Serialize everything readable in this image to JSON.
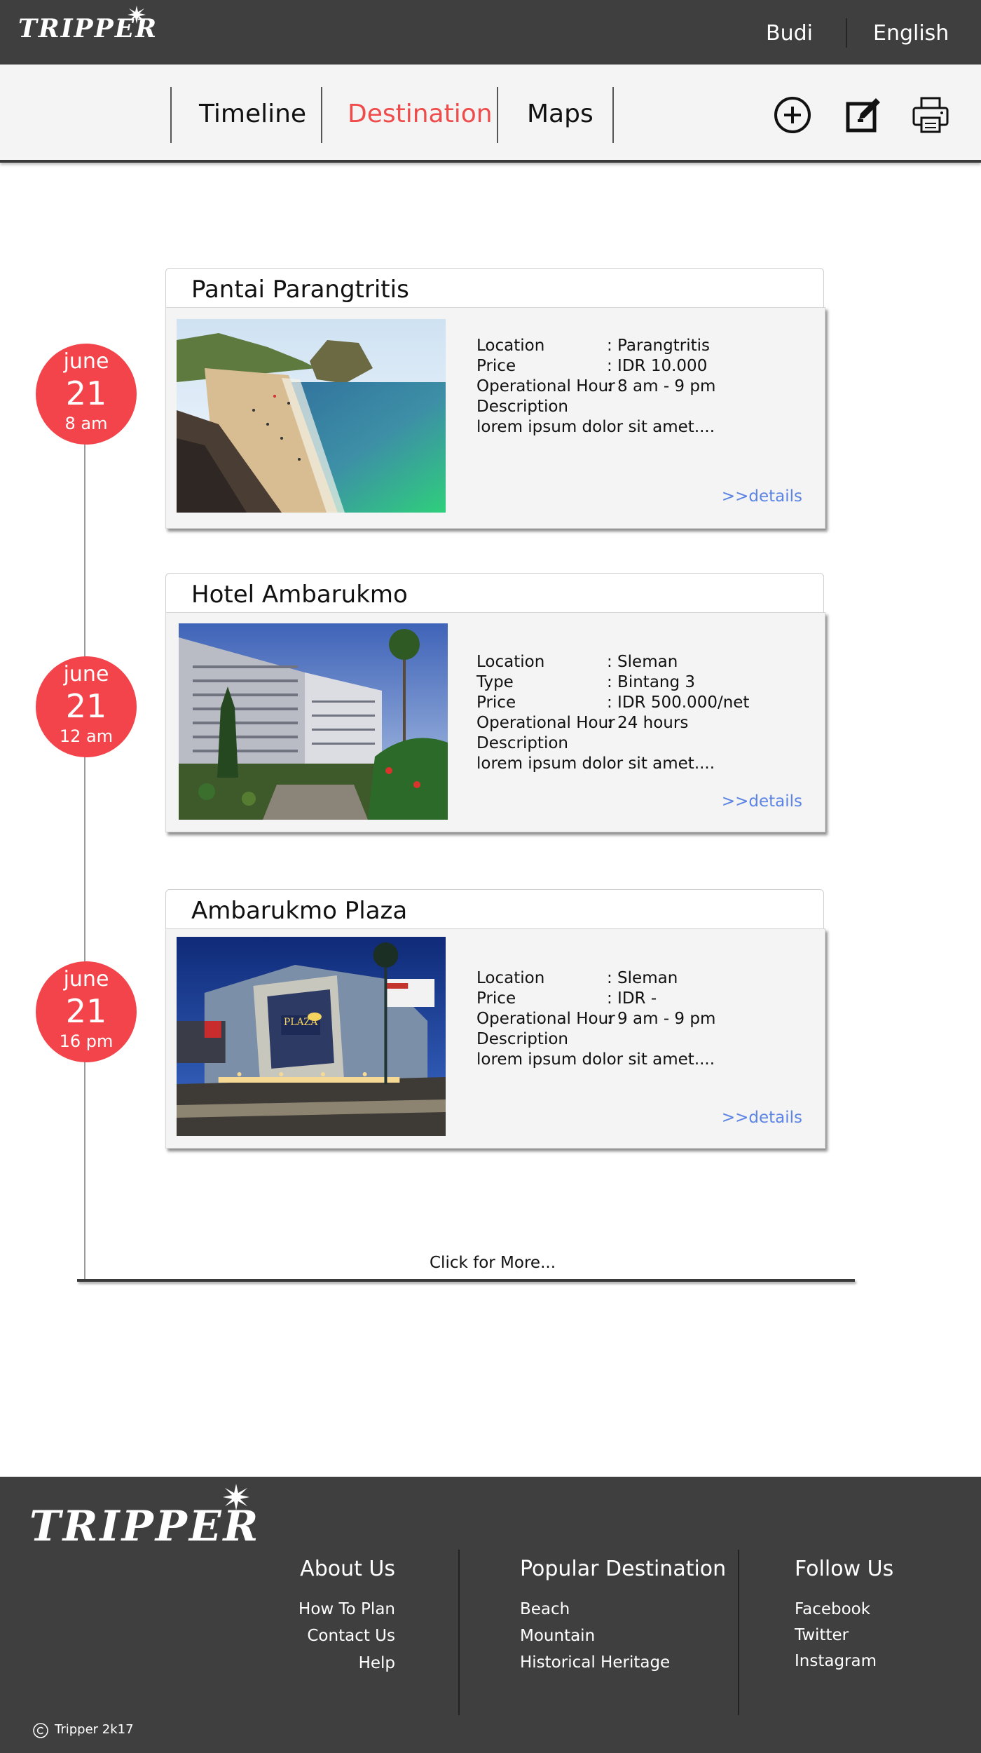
{
  "header": {
    "brand": "TRIPPER",
    "user": "Budi",
    "language": "English"
  },
  "nav": {
    "tabs": [
      "Timeline",
      "Destination",
      "Maps"
    ],
    "active_tab": "Destination",
    "icons": [
      "plus-circle-icon",
      "edit-icon",
      "printer-icon"
    ]
  },
  "timeline": [
    {
      "month": "june",
      "day": "21",
      "time": "8 am",
      "title": "Pantai Parangtritis",
      "image": "beach photo",
      "rows": [
        {
          "label": "Location",
          "value": ": Parangtritis"
        },
        {
          "label": "Price",
          "value": ": IDR 10.000"
        },
        {
          "label": "Operational Hour",
          "value": ": 8 am - 9 pm"
        },
        {
          "label": "Description",
          "value": ""
        },
        {
          "label": "lorem ipsum dolor sit amet....",
          "value": ""
        }
      ],
      "details": ">>details"
    },
    {
      "month": "june",
      "day": "21",
      "time": "12 am",
      "title": "Hotel Ambarukmo",
      "image": "hotel photo",
      "rows": [
        {
          "label": "Location",
          "value": ": Sleman"
        },
        {
          "label": "Type",
          "value": ": Bintang 3"
        },
        {
          "label": "Price",
          "value": ": IDR 500.000/net"
        },
        {
          "label": "Operational Hour",
          "value": ": 24 hours"
        },
        {
          "label": "Description",
          "value": ""
        },
        {
          "label": "lorem ipsum dolor sit amet....",
          "value": ""
        }
      ],
      "details": ">>details"
    },
    {
      "month": "june",
      "day": "21",
      "time": "16 pm",
      "title": "Ambarukmo Plaza",
      "image": "mall photo",
      "rows": [
        {
          "label": "Location",
          "value": ": Sleman"
        },
        {
          "label": "Price",
          "value": ": IDR -"
        },
        {
          "label": "Operational Hour",
          "value": ": 9 am - 9 pm"
        },
        {
          "label": "Description",
          "value": ""
        },
        {
          "label": "lorem ipsum dolor sit amet....",
          "value": ""
        }
      ],
      "details": ">>details"
    }
  ],
  "more": "Click for More...",
  "footer": {
    "brand": "TRIPPER",
    "columns": [
      {
        "title": "About Us",
        "links": [
          "How To Plan",
          "Contact Us",
          "Help"
        ]
      },
      {
        "title": "Popular Destination",
        "links": [
          "Beach",
          "Mountain",
          "Historical Heritage"
        ]
      },
      {
        "title": "Follow Us",
        "links": [
          "Facebook",
          "Twitter",
          "Instagram"
        ]
      }
    ],
    "copyright": "Tripper 2k17"
  },
  "colors": {
    "dark": "#3f3f3f",
    "accent": "#f04b4b",
    "circle": "#f2444a",
    "link": "#5b84e4",
    "panel": "#f4f4f4"
  }
}
